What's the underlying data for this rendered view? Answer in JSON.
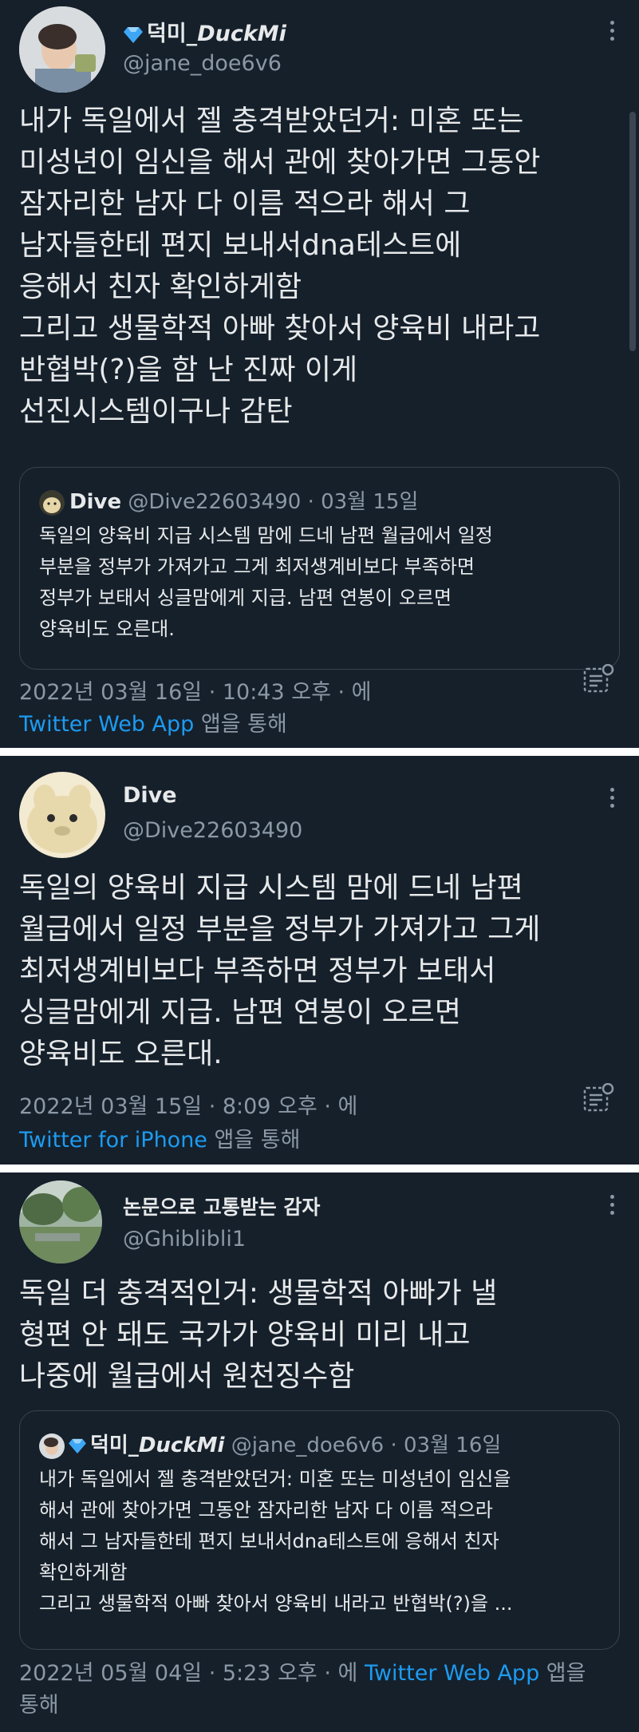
{
  "tweet1": {
    "name_prefix": "덕미_",
    "name_italic": "DuckMi",
    "handle": "@jane_doe6v6",
    "text": "내가 독일에서 젤 충격받았던거: 미혼 또는\n미성년이 임신을 해서 관에 찾아가면 그동안\n잠자리한 남자 다 이름 적으라 해서 그\n남자들한테 편지 보내서dna테스트에\n응해서 친자 확인하게함\n그리고 생물학적 아빠 찾아서 양육비 내라고\n반협박(?)을 함 난 진짜 이게\n선진시스템이구나 감탄",
    "quote": {
      "name": "Dive",
      "handle_date": "@Dive22603490 · 03월 15일",
      "text": "독일의 양육비 지급 시스템 맘에 드네 남편 월급에서 일정\n부분을 정부가 가져가고 그게 최저생계비보다 부족하면\n정부가 보태서 싱글맘에게 지급. 남편 연봉이 오르면\n양육비도 오른대."
    },
    "timestamp": "2022년 03월 16일 · 10:43 오후 · 에",
    "source_app": "Twitter Web App",
    "source_suffix": " 앱을 통해"
  },
  "tweet2": {
    "name": "Dive",
    "handle": "@Dive22603490",
    "text": "독일의 양육비 지급 시스템 맘에 드네 남편\n월급에서 일정 부분을 정부가 가져가고 그게\n최저생계비보다 부족하면 정부가 보태서\n싱글맘에게 지급. 남편 연봉이 오르면\n양육비도 오른대.",
    "timestamp": "2022년 03월 15일 · 8:09 오후 · 에",
    "source_app": "Twitter for iPhone",
    "source_suffix": " 앱을 통해"
  },
  "tweet3": {
    "name": "논문으로 고통받는 감자",
    "handle": "@Ghiblibli1",
    "text": "독일 더 충격적인거: 생물학적 아빠가 낼\n형편 안 돼도 국가가 양육비 미리 내고\n나중에 월급에서 원천징수함",
    "quote": {
      "name_prefix": "덕미_",
      "name_italic": "DuckMi",
      "handle_date": " @jane_doe6v6 · 03월 16일",
      "text": "내가 독일에서 젤 충격받았던거: 미혼 또는 미성년이 임신을\n해서 관에 찾아가면 그동안 잠자리한 남자 다 이름 적으라\n해서 그 남자들한테 편지 보내서dna테스트에 응해서 친자\n확인하게함\n그리고 생물학적 아빠 찾아서 양육비 내라고 반협박(?)을 ..."
    },
    "timestamp": "2022년 05월 04일 · 5:23 오후 · 에 ",
    "source_app": "Twitter Web App",
    "source_suffix": " 앱을",
    "source_suffix2": "통해"
  },
  "colors": {
    "background": "#15202b",
    "text": "#e7e9ea",
    "secondary": "#8b98a5",
    "link": "#1d9bf0",
    "border": "#38444d",
    "verified_diamond": "#3ea7f5"
  }
}
